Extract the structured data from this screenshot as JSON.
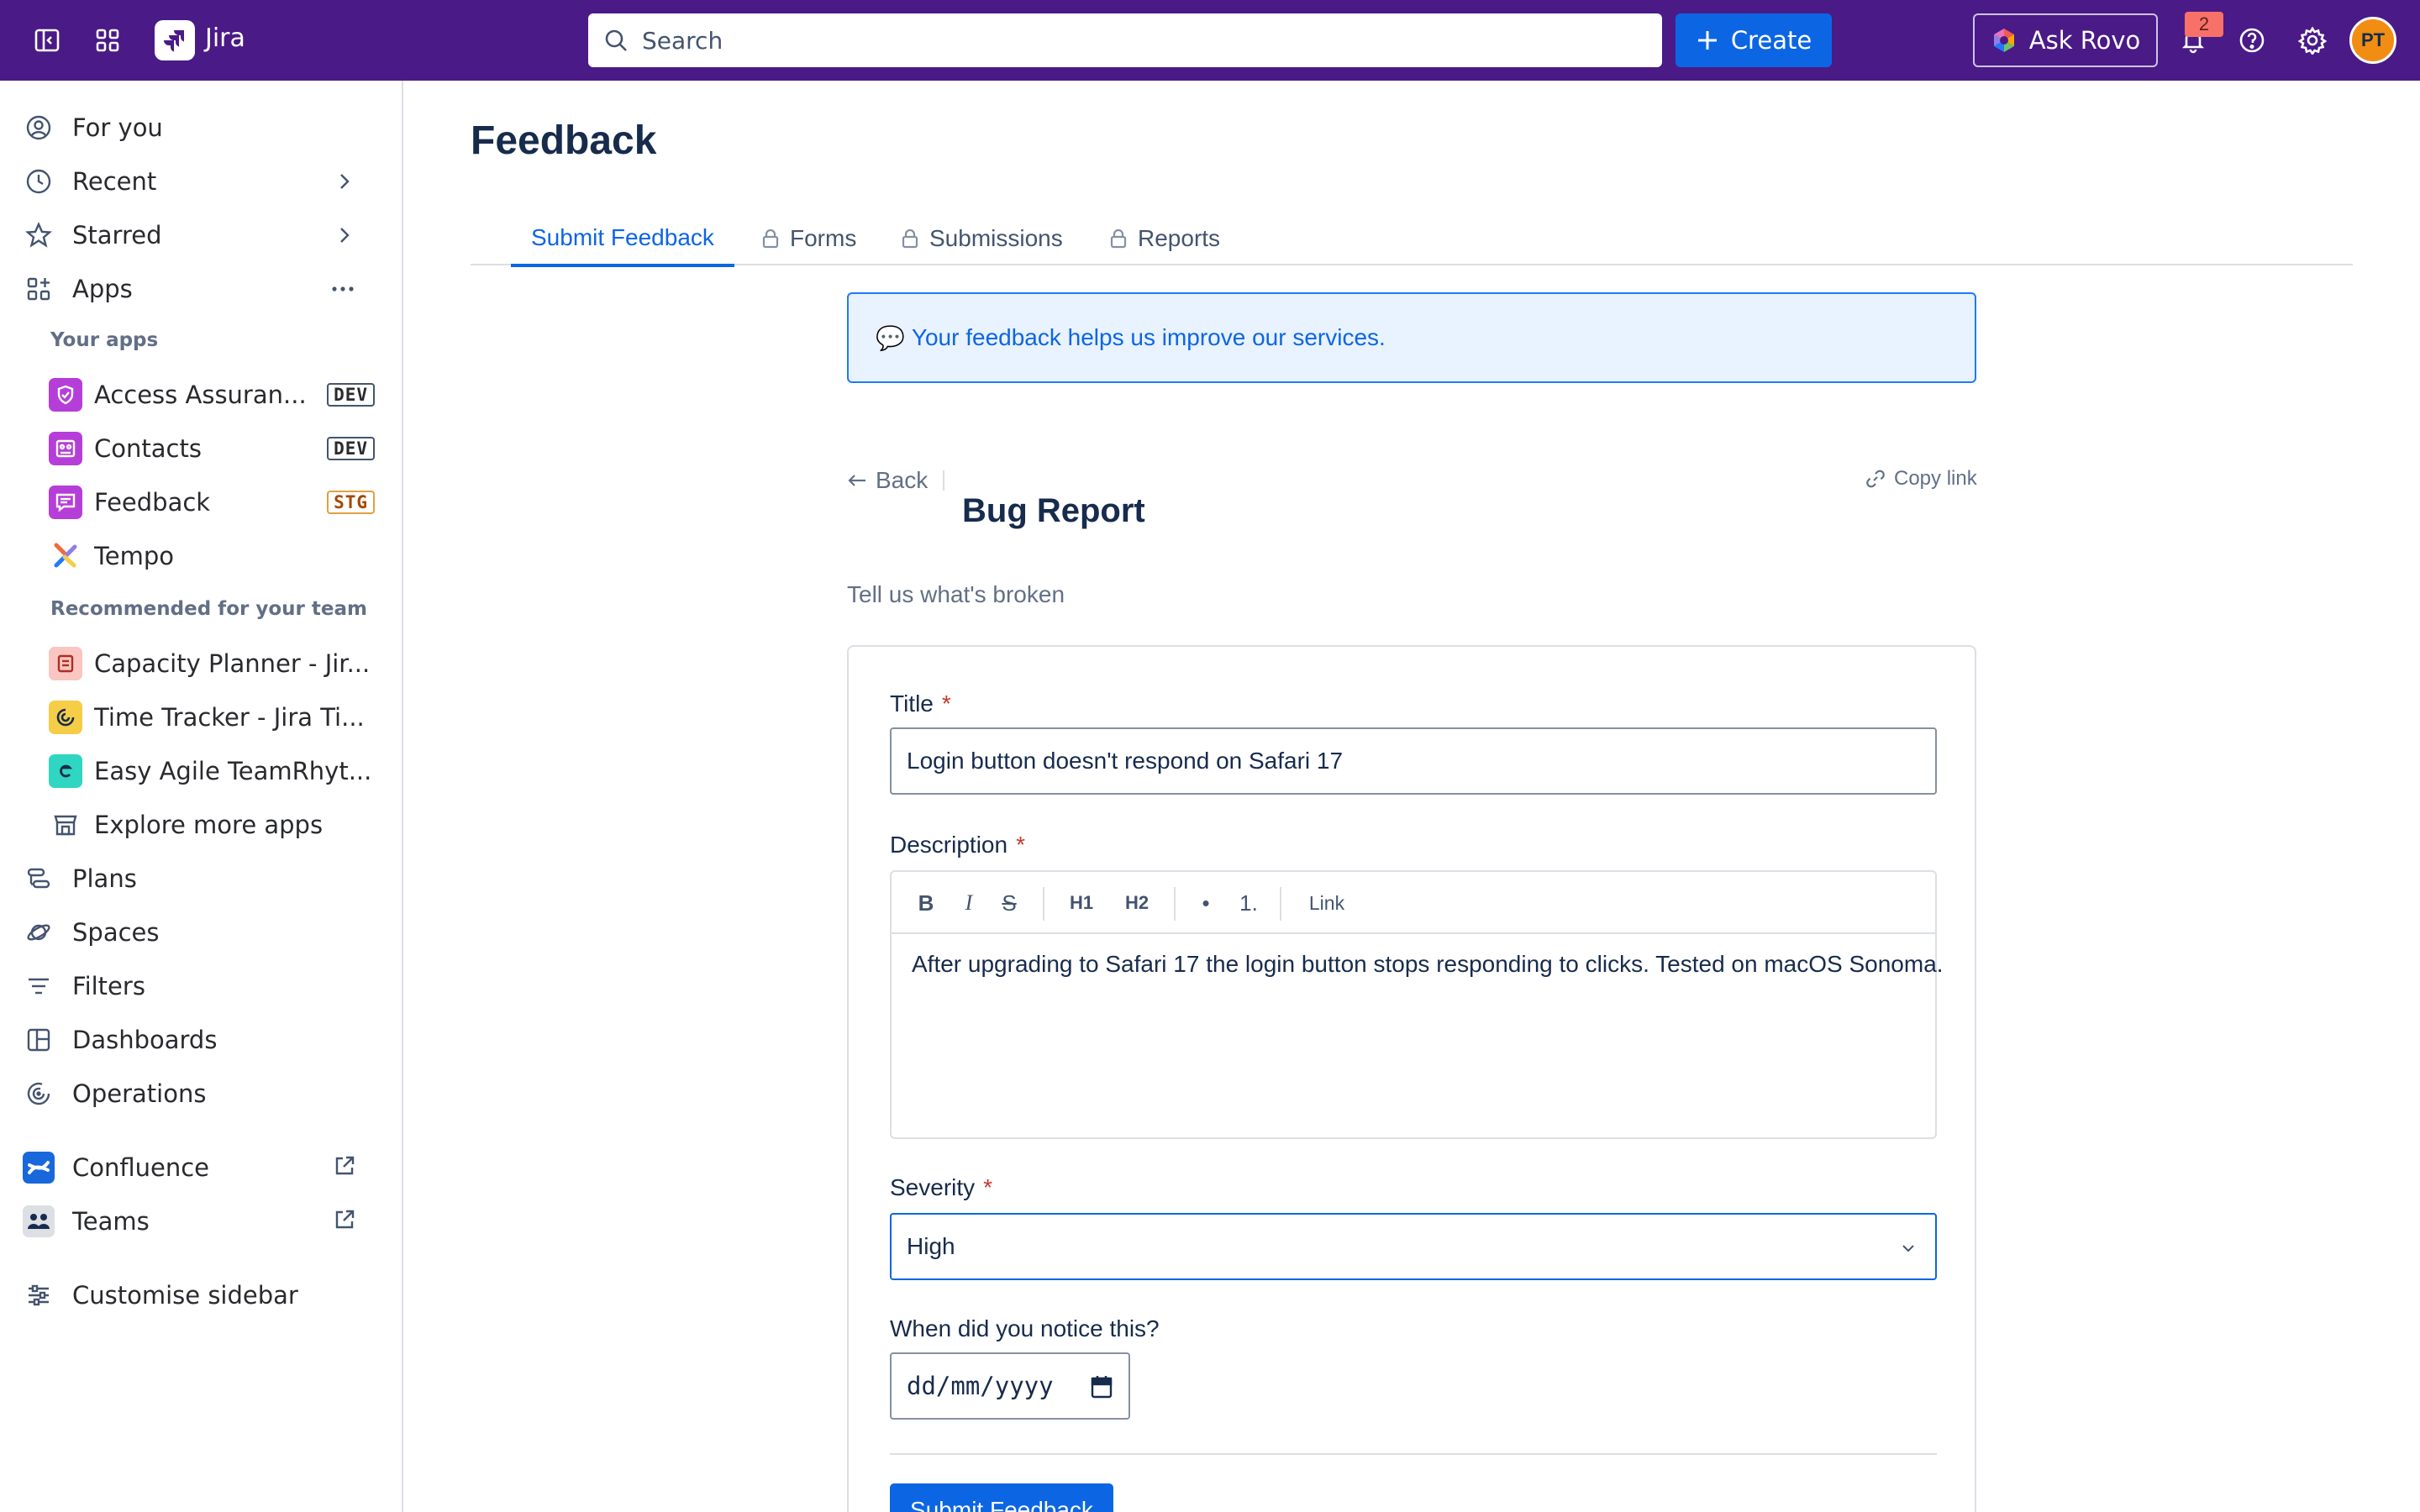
{
  "topbar": {
    "app_name": "Jira",
    "search_placeholder": "Search",
    "create_label": "Create",
    "ask_rovo_label": "Ask Rovo",
    "notification_count": "2",
    "avatar_initials": "PT",
    "colors": {
      "bar": "#4a1a87",
      "create": "#0c66e4",
      "avatar": "#f18d13"
    },
    "icons": [
      "sidebar-toggle-icon",
      "app-switcher-icon",
      "search-icon",
      "plus-icon",
      "rovo-icon",
      "bell-icon",
      "help-icon",
      "gear-icon"
    ]
  },
  "sidebar": {
    "for_you": "For you",
    "recent": "Recent",
    "starred": "Starred",
    "apps": "Apps",
    "your_apps_heading": "Your apps",
    "your_apps": [
      {
        "label": "Access Assuran...",
        "env": "DEV",
        "color": "#b53ed8"
      },
      {
        "label": "Contacts",
        "env": "DEV",
        "color": "#b53ed8"
      },
      {
        "label": "Feedback",
        "env": "STG",
        "color": "#b53ed8"
      },
      {
        "label": "Tempo",
        "env": "",
        "color": "#f06a3c"
      }
    ],
    "recommended_heading": "Recommended for your team",
    "recommended": [
      {
        "label": "Capacity Planner - Jir...",
        "color": "#f9c6c1"
      },
      {
        "label": "Time Tracker - Jira Ti...",
        "color": "#f5cd47"
      },
      {
        "label": "Easy Agile TeamRhyt...",
        "color": "#2fd6c1"
      }
    ],
    "explore": "Explore more apps",
    "plans": "Plans",
    "spaces": "Spaces",
    "filters": "Filters",
    "dashboards": "Dashboards",
    "operations": "Operations",
    "confluence": "Confluence",
    "teams": "Teams",
    "customise": "Customise sidebar"
  },
  "main": {
    "title": "Feedback",
    "tabs": [
      {
        "label": "Submit Feedback",
        "locked": false,
        "active": true
      },
      {
        "label": "Forms",
        "locked": true,
        "active": false
      },
      {
        "label": "Submissions",
        "locked": true,
        "active": false
      },
      {
        "label": "Reports",
        "locked": true,
        "active": false
      }
    ],
    "banner_emoji": "💬",
    "banner_text": "Your feedback helps us improve our services.",
    "back_label": "Back",
    "copy_link_label": "Copy link",
    "form_title": "Bug Report",
    "form_subtitle": "Tell us what's broken"
  },
  "form": {
    "title_label": "Title",
    "title_value": "Login button doesn't respond on Safari 17",
    "description_label": "Description",
    "toolbar": {
      "bold": "B",
      "italic": "I",
      "strike": "S",
      "h1": "H1",
      "h2": "H2",
      "bullet": "•",
      "numbered": "1.",
      "link": "Link"
    },
    "description_value": "After upgrading to Safari 17 the login button stops responding to clicks. Tested on macOS Sonoma.",
    "severity_label": "Severity",
    "severity_value": "High",
    "date_label": "When did you notice this?",
    "date_placeholder": "dd/mm/yyyy",
    "required_marker": "*",
    "submit_label": "Submit Feedback"
  }
}
